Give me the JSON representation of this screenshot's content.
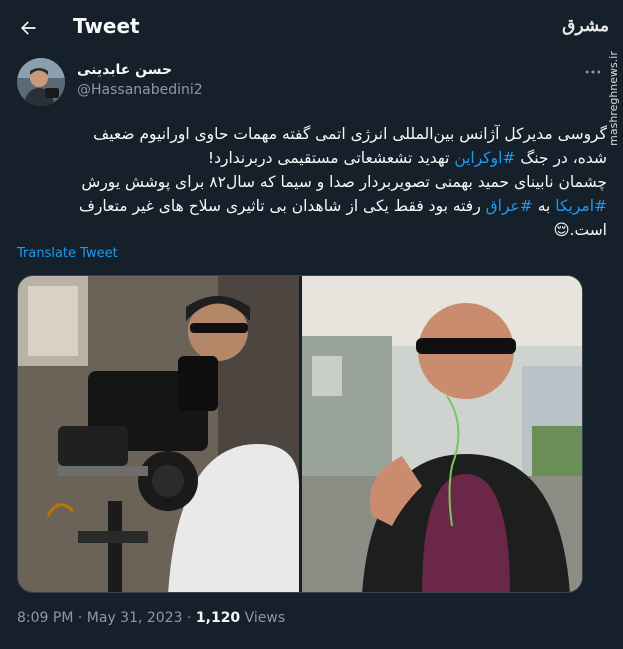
{
  "header": {
    "title": "Tweet",
    "back_icon": "arrow-left-icon"
  },
  "watermark": {
    "logo": "مشرق",
    "site": "mashreghnews.ir"
  },
  "author": {
    "display_name": "حسن عابدینی",
    "handle": "@Hassanabedini2"
  },
  "tweet": {
    "line1": "گروسی مدیرکل آژانس بین‌المللی انرژی اتمی گفته مهمات حاوی اورانیوم ضعیف",
    "line2_a": "شده، در جنگ ",
    "line2_tag": "#اوکراین",
    "line2_b": " تهدید تشعشعاتی مستقیمی دربرندارد!",
    "line3": "چشمان نابینای حمید بهمنی تصویربردار صدا و سیما که سال۸۲ برای پوشش یورش",
    "line4_tag1": "#امریکا",
    "line4_a": " به ",
    "line4_tag2": "#عراق",
    "line4_b": " رفته بود فقط یکی از شاهدان بی تاثیری سلاح های غیر متعارف",
    "line5": "است.",
    "emoji": "😌"
  },
  "translate_label": "Translate Tweet",
  "meta": {
    "time": "8:09 PM",
    "sep1": " · ",
    "date": "May 31, 2023",
    "sep2": " · ",
    "views_count": "1,120",
    "views_label": " Views"
  }
}
